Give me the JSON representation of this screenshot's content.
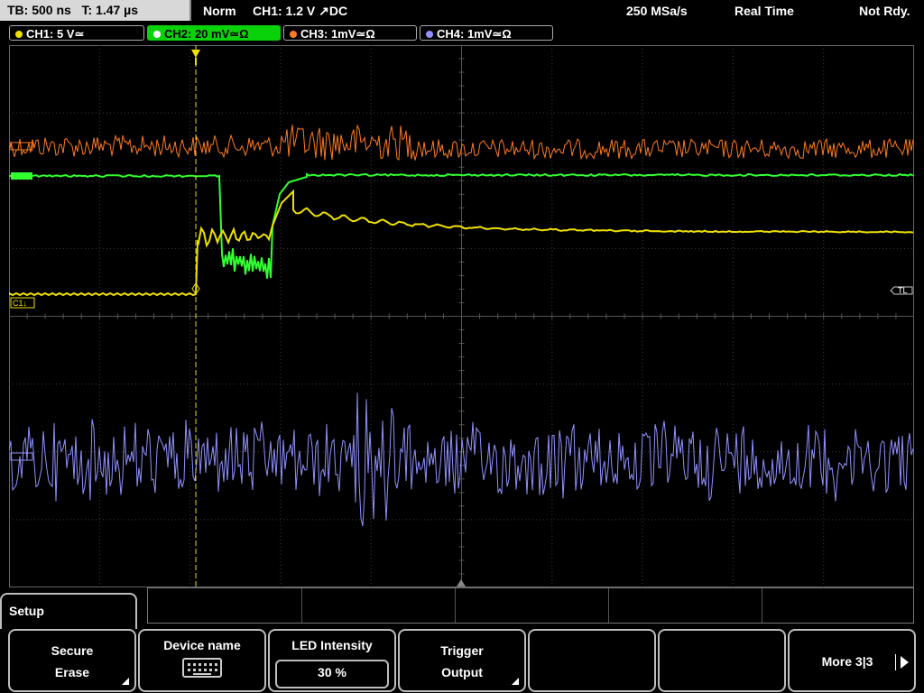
{
  "status": {
    "tb": "TB: 500 ns",
    "t": "T: 1.47 µs",
    "mode": "Norm",
    "trigger": "CH1: 1.2 V ↗DC",
    "sample_rate": "250 MSa/s",
    "acq": "Real Time",
    "state": "Not Rdy."
  },
  "channels": [
    {
      "label": "CH1: 5 V≃",
      "color": "#f0e000",
      "active": false
    },
    {
      "label": "CH2: 20 mV≃Ω",
      "color": "#30ff30",
      "active": true
    },
    {
      "label": "CH3: 1mV≃Ω",
      "color": "#ff7a20",
      "active": false
    },
    {
      "label": "CH4: 1mV≃Ω",
      "color": "#9090ff",
      "active": false
    }
  ],
  "markers": {
    "ch1": "C1↓",
    "trigger_level": "TL"
  },
  "setup_tab": "Setup",
  "softkeys": [
    {
      "line1": "Secure",
      "line2": "Erase"
    },
    {
      "line1": "Device name",
      "icon": "keyboard-icon"
    },
    {
      "line1": "LED Intensity",
      "value": "30 %"
    },
    {
      "line1": "Trigger",
      "line2": "Output"
    },
    {
      "line1": ""
    },
    {
      "line1": ""
    },
    {
      "line1": "More 3|3"
    }
  ],
  "colors": {
    "ch1": "#f0e000",
    "ch2": "#30ff30",
    "ch3": "#ff7a20",
    "ch4": "#9090ff",
    "grid": "#3c3c3c"
  }
}
